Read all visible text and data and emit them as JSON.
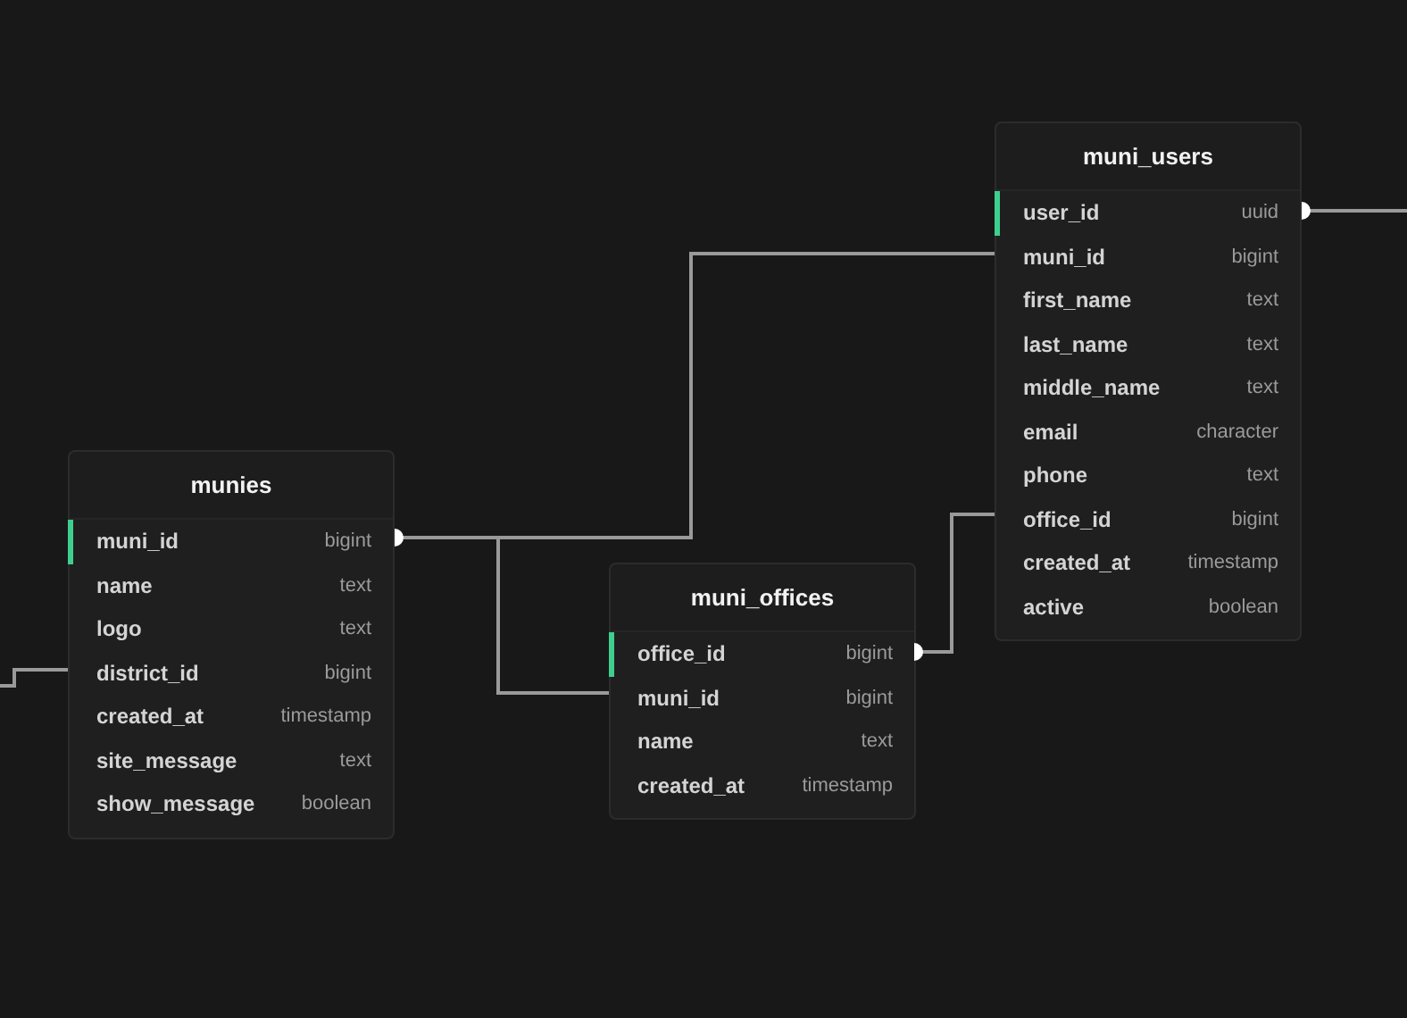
{
  "tables": [
    {
      "name": "munies",
      "columns": [
        {
          "name": "muni_id",
          "type": "bigint",
          "primary": true
        },
        {
          "name": "name",
          "type": "text",
          "primary": false
        },
        {
          "name": "logo",
          "type": "text",
          "primary": false
        },
        {
          "name": "district_id",
          "type": "bigint",
          "primary": false
        },
        {
          "name": "created_at",
          "type": "timestamp",
          "primary": false
        },
        {
          "name": "site_message",
          "type": "text",
          "primary": false
        },
        {
          "name": "show_message",
          "type": "boolean",
          "primary": false
        }
      ]
    },
    {
      "name": "muni_offices",
      "columns": [
        {
          "name": "office_id",
          "type": "bigint",
          "primary": true
        },
        {
          "name": "muni_id",
          "type": "bigint",
          "primary": false
        },
        {
          "name": "name",
          "type": "text",
          "primary": false
        },
        {
          "name": "created_at",
          "type": "timestamp",
          "primary": false
        }
      ]
    },
    {
      "name": "muni_users",
      "columns": [
        {
          "name": "user_id",
          "type": "uuid",
          "primary": true
        },
        {
          "name": "muni_id",
          "type": "bigint",
          "primary": false
        },
        {
          "name": "first_name",
          "type": "text",
          "primary": false
        },
        {
          "name": "last_name",
          "type": "text",
          "primary": false
        },
        {
          "name": "middle_name",
          "type": "text",
          "primary": false
        },
        {
          "name": "email",
          "type": "character",
          "primary": false
        },
        {
          "name": "phone",
          "type": "text",
          "primary": false
        },
        {
          "name": "office_id",
          "type": "bigint",
          "primary": false
        },
        {
          "name": "created_at",
          "type": "timestamp",
          "primary": false
        },
        {
          "name": "active",
          "type": "boolean",
          "primary": false
        }
      ]
    }
  ]
}
